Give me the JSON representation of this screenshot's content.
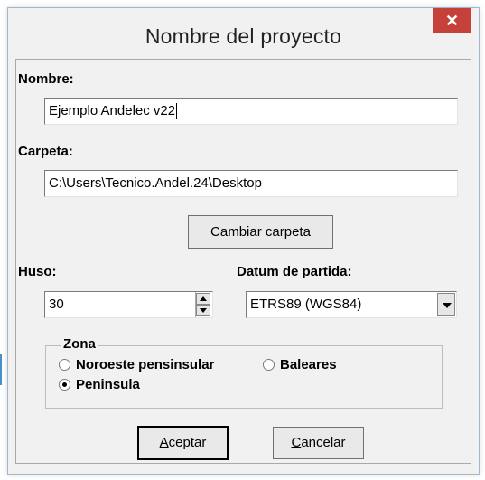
{
  "window": {
    "title": "Nombre del proyecto",
    "close_glyph": "✕"
  },
  "nombre": {
    "label": "Nombre:",
    "value": "Ejemplo Andelec v22"
  },
  "carpeta": {
    "label": "Carpeta:",
    "value": "C:\\Users\\Tecnico.Andel.24\\Desktop"
  },
  "cambiar_button": "Cambiar carpeta",
  "huso": {
    "label": "Huso:",
    "value": "30"
  },
  "datum": {
    "label": "Datum de partida:",
    "selected": "ETRS89 (WGS84)"
  },
  "zona": {
    "title": "Zona",
    "options": [
      {
        "label": "Noroeste pensinsular",
        "checked": false
      },
      {
        "label": "Baleares",
        "checked": false
      },
      {
        "label": "Peninsula",
        "checked": true
      }
    ]
  },
  "buttons": {
    "aceptar_mnemonic": "A",
    "aceptar_rest": "ceptar",
    "cancelar_mnemonic": "C",
    "cancelar_rest": "ancelar"
  }
}
